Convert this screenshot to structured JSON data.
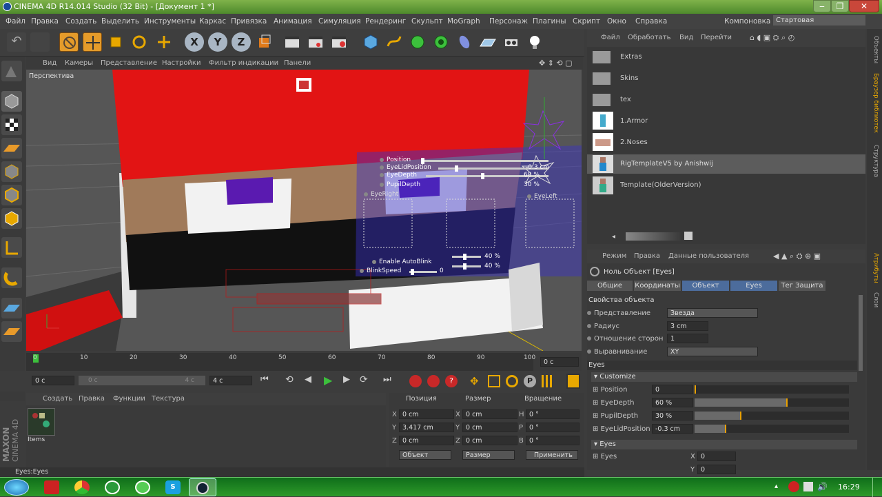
{
  "window": {
    "title": "CINEMA 4D R14.014 Studio (32 Bit) - [Документ 1 *]",
    "min": "‒",
    "max": "❐",
    "close": "✕"
  },
  "menu": {
    "items": [
      "Файл",
      "Правка",
      "Создать",
      "Выделить",
      "Инструменты",
      "Каркас",
      "Привязка",
      "Анимация",
      "Симуляция",
      "Рендеринг",
      "Скульпт",
      "MoGraph",
      "Персонаж",
      "Плагины",
      "Скрипт",
      "Окно",
      "Справка"
    ],
    "layout_label": "Компоновка",
    "layout_value": "Стартовая"
  },
  "viewport": {
    "menu": [
      "Вид",
      "Камеры",
      "Представление",
      "Настройки",
      "Фильтр индикации",
      "Панели"
    ],
    "label": "Перспектива",
    "hud": {
      "position": "Position",
      "eyelidposition": "EyeLidPosition",
      "eyedepth": "EyeDepth",
      "pupildepth": "PupilDepth",
      "eyeright": "EyeRight",
      "eyeleft": "EyeLeft",
      "v1": "-0.3 cm",
      "v2": "60 %",
      "v3": "30 %",
      "blink": "Enable AutoBlink",
      "blinkspeed": "BlinkSpeed",
      "blinkval": "0",
      "p40a": "40 %",
      "p40b": "40 %"
    }
  },
  "timeline": {
    "ticks": [
      "0",
      "10",
      "20",
      "30",
      "40",
      "50",
      "60",
      "70",
      "80",
      "90",
      "100"
    ],
    "frame": "0 c",
    "start": "0 c",
    "end": "4 c",
    "range_end": "4 c",
    "range_start": "0 c"
  },
  "material": {
    "menu": [
      "Создать",
      "Правка",
      "Функции",
      "Текстура"
    ],
    "item": "Items"
  },
  "coords": {
    "headers": [
      "Позиция",
      "Размер",
      "Вращение"
    ],
    "rows": [
      [
        "X",
        "0 cm",
        "X",
        "0 cm",
        "H",
        "0 °"
      ],
      [
        "Y",
        "3.417 cm",
        "Y",
        "0 cm",
        "P",
        "0 °"
      ],
      [
        "Z",
        "0 cm",
        "Z",
        "0 cm",
        "B",
        "0 °"
      ]
    ],
    "mode1": "Объект",
    "mode2": "Размер",
    "apply": "Применить"
  },
  "objects": {
    "menu": [
      "Файл",
      "Обработать",
      "Вид",
      "Перейти"
    ],
    "items": [
      "Extras",
      "Skins",
      "tex",
      "1.Armor",
      "2.Noses",
      "RigTemplateV5 by Anishwij",
      "Template(OlderVersion)"
    ]
  },
  "attributes": {
    "menu": [
      "Режим",
      "Правка",
      "Данные пользователя"
    ],
    "title": "Ноль Объект [Eyes]",
    "tabs": [
      "Общие",
      "Координаты",
      "Объект",
      "Eyes",
      "Тег Защита"
    ],
    "section": "Свойства объекта",
    "props": [
      {
        "label": "Представление",
        "value": "Звезда"
      },
      {
        "label": "Радиус",
        "value": "3 cm"
      },
      {
        "label": "Отношение сторон",
        "value": "1"
      },
      {
        "label": "Выравнивание",
        "value": "XY"
      }
    ],
    "group": "Eyes",
    "customize": "Customize",
    "sliders": [
      {
        "label": "Position",
        "value": "0",
        "level": 0
      },
      {
        "label": "EyeDepth",
        "value": "60 %",
        "level": 0.6
      },
      {
        "label": "PupilDepth",
        "value": "30 %",
        "level": 0.3
      },
      {
        "label": "EyeLidPosition",
        "value": "-0.3 cm",
        "level": 0.2
      }
    ],
    "eyes_group": "Eyes",
    "eyes_label": "Eyes",
    "x": "X",
    "y": "Y",
    "x_val": "0",
    "y_val": "0"
  },
  "side_tabs": [
    "Объекты",
    "Браузер библиотек",
    "Структура",
    "Атрибуты",
    "Слои"
  ],
  "status": "Eyes:Eyes",
  "taskbar": {
    "time": "16:29"
  },
  "brand": {
    "line1": "MAXON",
    "line2": "CINEMA 4D"
  }
}
